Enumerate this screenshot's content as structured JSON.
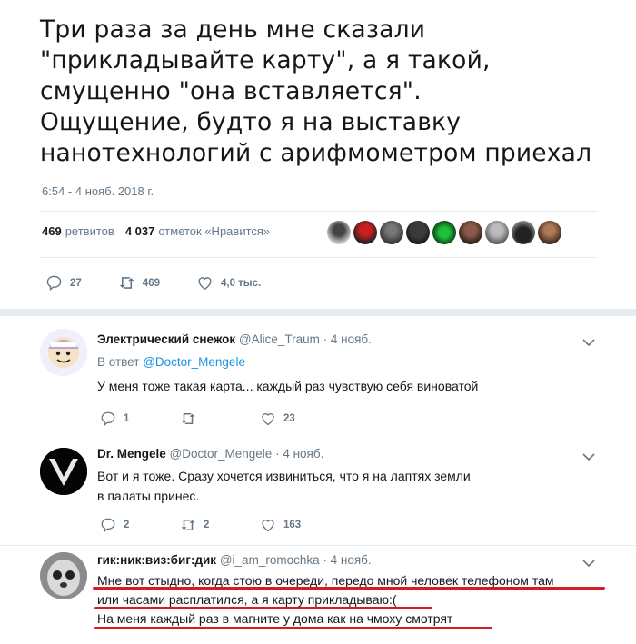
{
  "tweet": {
    "text_lines": [
      "Три раза за день мне сказали",
      "\"прикладывайте карту\", а я такой,",
      "смущенно \"она вставляется\".",
      "Ощущение, будто я на выставку",
      "нанотехнологий с арифмометром приехал"
    ],
    "timestamp": "6:54 - 4 нояб. 2018 г.",
    "retweets_count": "469",
    "retweets_label": "ретвитов",
    "likes_count": "4 037",
    "likes_label": "отметок «Нравится»",
    "actions": {
      "replies": "27",
      "retweets": "469",
      "likes": "4,0 тыс."
    }
  },
  "replies": [
    {
      "name": "Электрический снежок",
      "handle": "@Alice_Traum",
      "date": "4 нояб.",
      "in_reply_prefix": "В ответ",
      "in_reply_handle": "@Doctor_Mengele",
      "text": "У меня тоже такая карта... каждый раз чувствую себя виноватой",
      "replies": "1",
      "retweets": "",
      "likes": "23"
    },
    {
      "name": "Dr. Mengele",
      "handle": "@Doctor_Mengele",
      "date": "4 нояб.",
      "text": "Вот и я тоже. Сразу хочется извиниться, что я на лаптях земли  в палаты принес.",
      "replies": "2",
      "retweets": "2",
      "likes": "163"
    },
    {
      "name": "гик:ник:виз:биг:дик",
      "handle": "@i_am_romochka",
      "date": "4 нояб.",
      "text_lines": [
        "Мне вот стыдно, когда стою в очереди, передо мной человек телефоном там",
        "или часами расплатился, а я карту прикладываю:(",
        "На меня каждый раз в магните у дома как на чмоху смотрят"
      ]
    }
  ],
  "colors": {
    "text": "#14171a",
    "muted": "#657786",
    "link": "#1b95e0",
    "underline": "#d91a24"
  }
}
